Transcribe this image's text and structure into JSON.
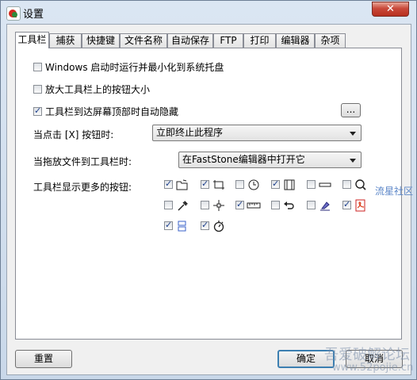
{
  "window": {
    "title": "设置",
    "close_label": "✕"
  },
  "tabs": [
    {
      "label": "工具栏",
      "active": true
    },
    {
      "label": "捕获"
    },
    {
      "label": "快捷键"
    },
    {
      "label": "文件名称"
    },
    {
      "label": "自动保存"
    },
    {
      "label": "FTP"
    },
    {
      "label": "打印"
    },
    {
      "label": "编辑器"
    },
    {
      "label": "杂项"
    }
  ],
  "options": {
    "win_startup": {
      "label": "Windows 启动时运行并最小化到系统托盘",
      "checked": false
    },
    "enlarge_buttons": {
      "label": "放大工具栏上的按钮大小",
      "checked": false
    },
    "auto_hide": {
      "label": "工具栏到达屏幕顶部时自动隐藏",
      "checked": true
    },
    "more_button": "..."
  },
  "close_action": {
    "label": "当点击 [X] 按钮时:",
    "value": "立即终止此程序"
  },
  "drop_action": {
    "label": "当拖放文件到工具栏时:",
    "value": "在FastStone编辑器中打开它"
  },
  "extra_buttons": {
    "label": "工具栏显示更多的按钮:",
    "items": [
      {
        "icon": "open-folder-icon",
        "checked": true
      },
      {
        "icon": "crop-rect-icon",
        "checked": true
      },
      {
        "icon": "clock-icon",
        "checked": false
      },
      {
        "icon": "film-strip-icon",
        "checked": true
      },
      {
        "icon": "bar-rect-icon",
        "checked": false
      },
      {
        "icon": "magnifier-icon",
        "checked": false
      },
      {
        "icon": "color-picker-icon",
        "checked": false
      },
      {
        "icon": "crosshair-icon",
        "checked": false
      },
      {
        "icon": "ruler-icon",
        "checked": true
      },
      {
        "icon": "undo-arrow-icon",
        "checked": false
      },
      {
        "icon": "highlighter-icon",
        "checked": false
      },
      {
        "icon": "pdf-icon",
        "checked": true
      },
      {
        "icon": "screen-compare-icon",
        "checked": true
      },
      {
        "icon": "timer-icon",
        "checked": true
      }
    ]
  },
  "footer": {
    "reset": "重置",
    "ok": "确定",
    "cancel": "取消"
  },
  "watermarks": {
    "side": "流星社区",
    "bottom_cn": "吾爱破解论坛",
    "bottom_url": "www.52pojie.cn"
  }
}
